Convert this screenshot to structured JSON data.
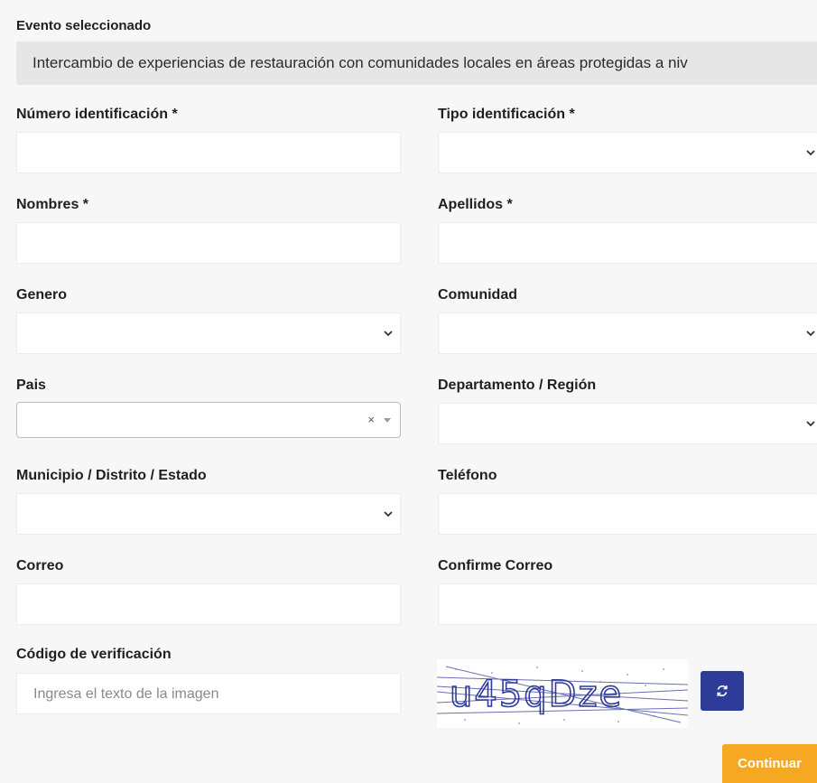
{
  "evento": {
    "label": "Evento seleccionado",
    "value": "Intercambio de experiencias de restauración con comunidades locales en áreas protegidas a niv"
  },
  "form": {
    "numero_identificacion": {
      "label": "Número identificación *",
      "value": ""
    },
    "tipo_identificacion": {
      "label": "Tipo identificación *",
      "value": ""
    },
    "nombres": {
      "label": "Nombres *",
      "value": ""
    },
    "apellidos": {
      "label": "Apellidos *",
      "value": ""
    },
    "genero": {
      "label": "Genero",
      "value": ""
    },
    "comunidad": {
      "label": "Comunidad",
      "value": ""
    },
    "pais": {
      "label": "Pais",
      "value": "",
      "clear_glyph": "×"
    },
    "departamento": {
      "label": "Departamento / Región",
      "value": ""
    },
    "municipio": {
      "label": "Municipio / Distrito / Estado",
      "value": ""
    },
    "telefono": {
      "label": "Teléfono",
      "value": ""
    },
    "correo": {
      "label": "Correo",
      "value": ""
    },
    "confirme_correo": {
      "label": "Confirme Correo",
      "value": ""
    },
    "codigo": {
      "label": "Código de verificación",
      "placeholder": "Ingresa el texto de la imagen",
      "value": ""
    }
  },
  "captcha": {
    "text": "u45qDze"
  },
  "buttons": {
    "continuar": "Continuar"
  },
  "colors": {
    "refresh_button": "#2f3b98",
    "continue_button": "#f7a823",
    "event_box": "#e6e6e6"
  },
  "icons": {
    "select_arrow": "chevron-down-icon",
    "refresh": "refresh-icon",
    "clear": "clear-icon",
    "dropdown": "caret-down-icon"
  }
}
